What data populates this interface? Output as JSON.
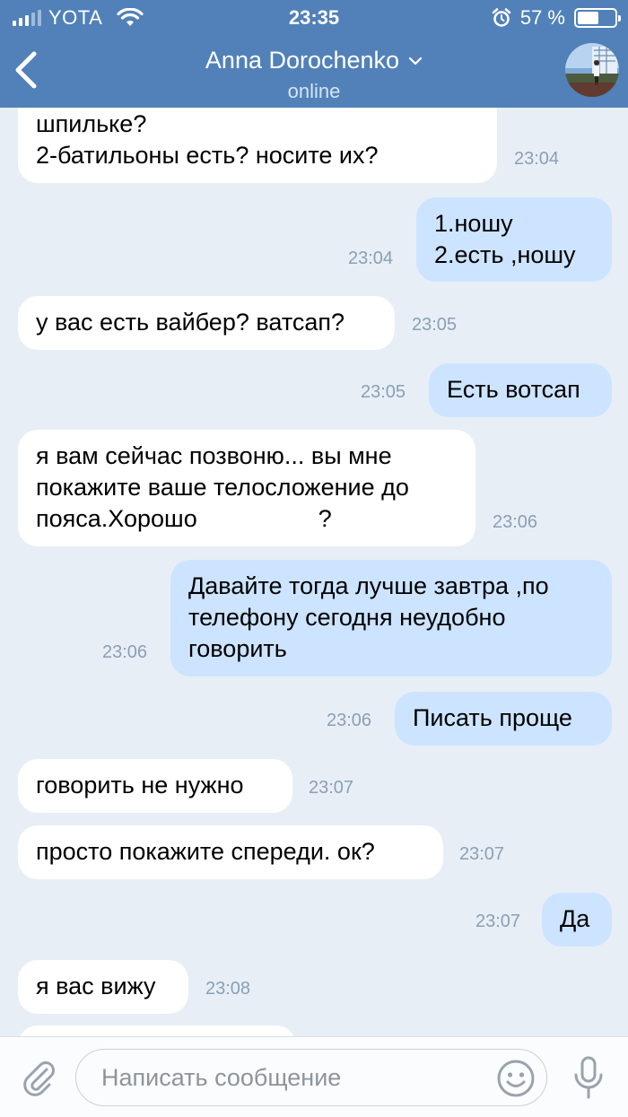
{
  "status_bar": {
    "carrier": "YOTA",
    "time": "23:35",
    "battery": "57 %",
    "battery_level": 0.57
  },
  "header": {
    "title": "Anna Dorochenko",
    "subtitle": "online",
    "icons": [
      "back-chevron-icon",
      "dropdown-chevron-icon",
      "avatar"
    ]
  },
  "messages": [
    {
      "dir": "in",
      "lines": [
        "шпильке?",
        "2-батильоны есть? носите их?"
      ],
      "time": "23:04"
    },
    {
      "dir": "out",
      "lines": [
        "1.ношу",
        "2.есть ,ношу"
      ],
      "time": "23:04"
    },
    {
      "dir": "in",
      "lines": [
        "у вас есть вайбер? ватсап?"
      ],
      "time": "23:05"
    },
    {
      "dir": "out",
      "lines": [
        "Есть вотсап"
      ],
      "time": "23:05"
    },
    {
      "dir": "in",
      "lines": [
        "я вам сейчас позвоню... вы мне",
        "покажите ваше телосложение до",
        "пояса.Хорошо                  ?"
      ],
      "time": "23:06"
    },
    {
      "dir": "out",
      "lines": [
        "Давайте тогда лучше завтра ,по",
        "телефону сегодня неудобно",
        "говорить"
      ],
      "time": "23:06"
    },
    {
      "dir": "out",
      "lines": [
        "Писать проще"
      ],
      "time": "23:06"
    },
    {
      "dir": "in",
      "lines": [
        "говорить не нужно"
      ],
      "time": "23:07"
    },
    {
      "dir": "in",
      "lines": [
        "просто покажите спереди. ок?"
      ],
      "time": "23:07"
    },
    {
      "dir": "out",
      "lines": [
        "Да"
      ],
      "time": "23:07"
    },
    {
      "dir": "in",
      "lines": [
        "я вас вижу"
      ],
      "time": "23:08"
    }
  ],
  "input": {
    "placeholder": "Написать сообщение",
    "icons": [
      "paperclip-icon",
      "emoji-icon",
      "microphone-icon"
    ]
  },
  "colors": {
    "header": "#5181b8",
    "background": "#e8eef6",
    "incoming": "#ffffff",
    "outgoing": "#cce4ff",
    "timestamp": "#8a9fb6"
  }
}
